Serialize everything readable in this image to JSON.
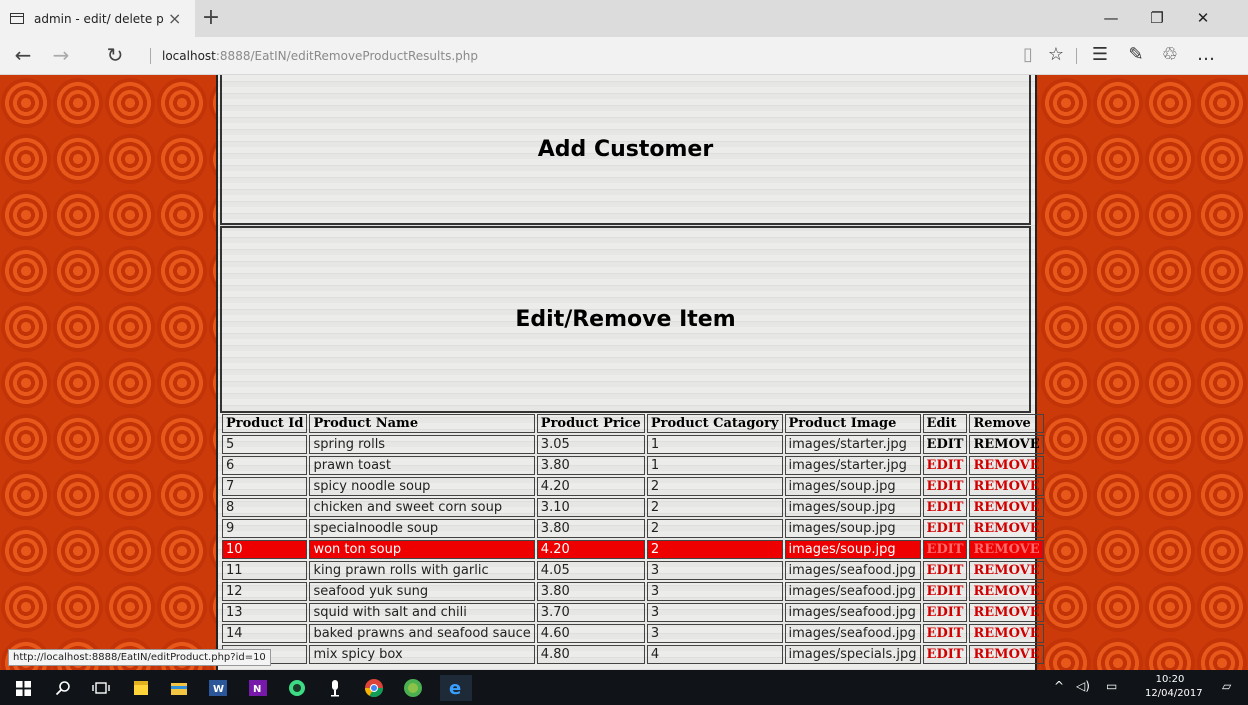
{
  "browser": {
    "tab_title": "admin - edit/ delete prc",
    "new_tab": "+",
    "url_host": "localhost",
    "url_rest": ":8888/EatIN/editRemoveProductResults.php",
    "status_url": "http://localhost:8888/EatIN/editProduct.php?id=10"
  },
  "icons": {
    "tab": "tab-icon",
    "close": "×",
    "back": "←",
    "forward": "→",
    "refresh": "↻",
    "reading": "▯",
    "star": "☆",
    "hub": "☰",
    "note": "✎",
    "share": "♲",
    "more": "…",
    "minimize": "—",
    "restore": "❐",
    "win_close": "✕"
  },
  "page": {
    "panel1_title": "Add Customer",
    "panel2_title": "Edit/Remove Item"
  },
  "table": {
    "headers": [
      "Product Id",
      "Product Name",
      "Product Price",
      "Product Catagory",
      "Product Image",
      "Edit",
      "Remove"
    ],
    "rows": [
      {
        "id": "5",
        "name": "spring rolls",
        "price": "3.05",
        "cat": "1",
        "img": "images/starter.jpg",
        "edit": "EDIT",
        "remove": "REMOVE"
      },
      {
        "id": "6",
        "name": "prawn toast",
        "price": "3.80",
        "cat": "1",
        "img": "images/starter.jpg",
        "edit": "EDIT",
        "remove": "REMOVE"
      },
      {
        "id": "7",
        "name": "spicy noodle soup",
        "price": "4.20",
        "cat": "2",
        "img": "images/soup.jpg",
        "edit": "EDIT",
        "remove": "REMOVE"
      },
      {
        "id": "8",
        "name": "chicken and sweet corn soup",
        "price": "3.10",
        "cat": "2",
        "img": "images/soup.jpg",
        "edit": "EDIT",
        "remove": "REMOVE"
      },
      {
        "id": "9",
        "name": "specialnoodle soup",
        "price": "3.80",
        "cat": "2",
        "img": "images/soup.jpg",
        "edit": "EDIT",
        "remove": "REMOVE"
      },
      {
        "id": "10",
        "name": "won ton soup",
        "price": "4.20",
        "cat": "2",
        "img": "images/soup.jpg",
        "edit": "EDIT",
        "remove": "REMOVE"
      },
      {
        "id": "11",
        "name": "king prawn rolls with garlic",
        "price": "4.05",
        "cat": "3",
        "img": "images/seafood.jpg",
        "edit": "EDIT",
        "remove": "REMOVE"
      },
      {
        "id": "12",
        "name": "seafood yuk sung",
        "price": "3.80",
        "cat": "3",
        "img": "images/seafood.jpg",
        "edit": "EDIT",
        "remove": "REMOVE"
      },
      {
        "id": "13",
        "name": "squid with salt and chili",
        "price": "3.70",
        "cat": "3",
        "img": "images/seafood.jpg",
        "edit": "EDIT",
        "remove": "REMOVE"
      },
      {
        "id": "14",
        "name": "baked prawns and seafood sauce",
        "price": "4.60",
        "cat": "3",
        "img": "images/seafood.jpg",
        "edit": "EDIT",
        "remove": "REMOVE"
      },
      {
        "id": "",
        "name": "mix spicy box",
        "price": "4.80",
        "cat": "4",
        "img": "images/specials.jpg",
        "edit": "EDIT",
        "remove": "REMOVE"
      }
    ]
  },
  "taskbar": {
    "time": "10:20",
    "date": "12/04/2017",
    "icons": [
      "windows-start-icon",
      "search-icon",
      "task-view-icon",
      "sticky-notes-icon",
      "file-explorer-icon",
      "word-icon",
      "onenote-icon",
      "android-studio-icon",
      "media-icon",
      "chrome-icon",
      "app-icon",
      "edge-icon"
    ]
  },
  "colors": {
    "accent_red": "#ee0000",
    "link_red": "#d10000"
  }
}
